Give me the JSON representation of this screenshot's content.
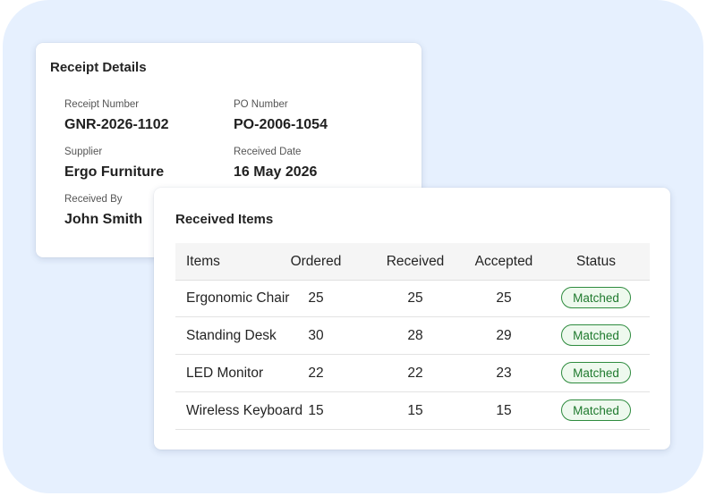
{
  "receipt": {
    "title": "Receipt Details",
    "fields": [
      {
        "label": "Receipt Number",
        "value": "GNR-2026-1102"
      },
      {
        "label": "PO Number",
        "value": "PO-2006-1054"
      },
      {
        "label": "Supplier",
        "value": "Ergo Furniture"
      },
      {
        "label": "Received Date",
        "value": "16 May 2026"
      },
      {
        "label": "Received By",
        "value": "John Smith"
      }
    ]
  },
  "items": {
    "title": "Received Items",
    "headers": [
      "Items",
      "Ordered",
      "Received",
      "Accepted",
      "Status"
    ],
    "rows": [
      {
        "item": "Ergonomic Chair",
        "ordered": "25",
        "received": "25",
        "accepted": "25",
        "status": "Matched"
      },
      {
        "item": "Standing Desk",
        "ordered": "30",
        "received": "28",
        "accepted": "29",
        "status": "Matched"
      },
      {
        "item": "LED Monitor",
        "ordered": "22",
        "received": "22",
        "accepted": "23",
        "status": "Matched"
      },
      {
        "item": "Wireless Keyboard",
        "ordered": "15",
        "received": "15",
        "accepted": "15",
        "status": "Matched"
      }
    ]
  },
  "colors": {
    "background_panel": "#e6f0fe",
    "status_matched_text": "#1f7a2e",
    "status_matched_border": "#2e8b3e",
    "status_matched_fill": "#eef9ee"
  }
}
